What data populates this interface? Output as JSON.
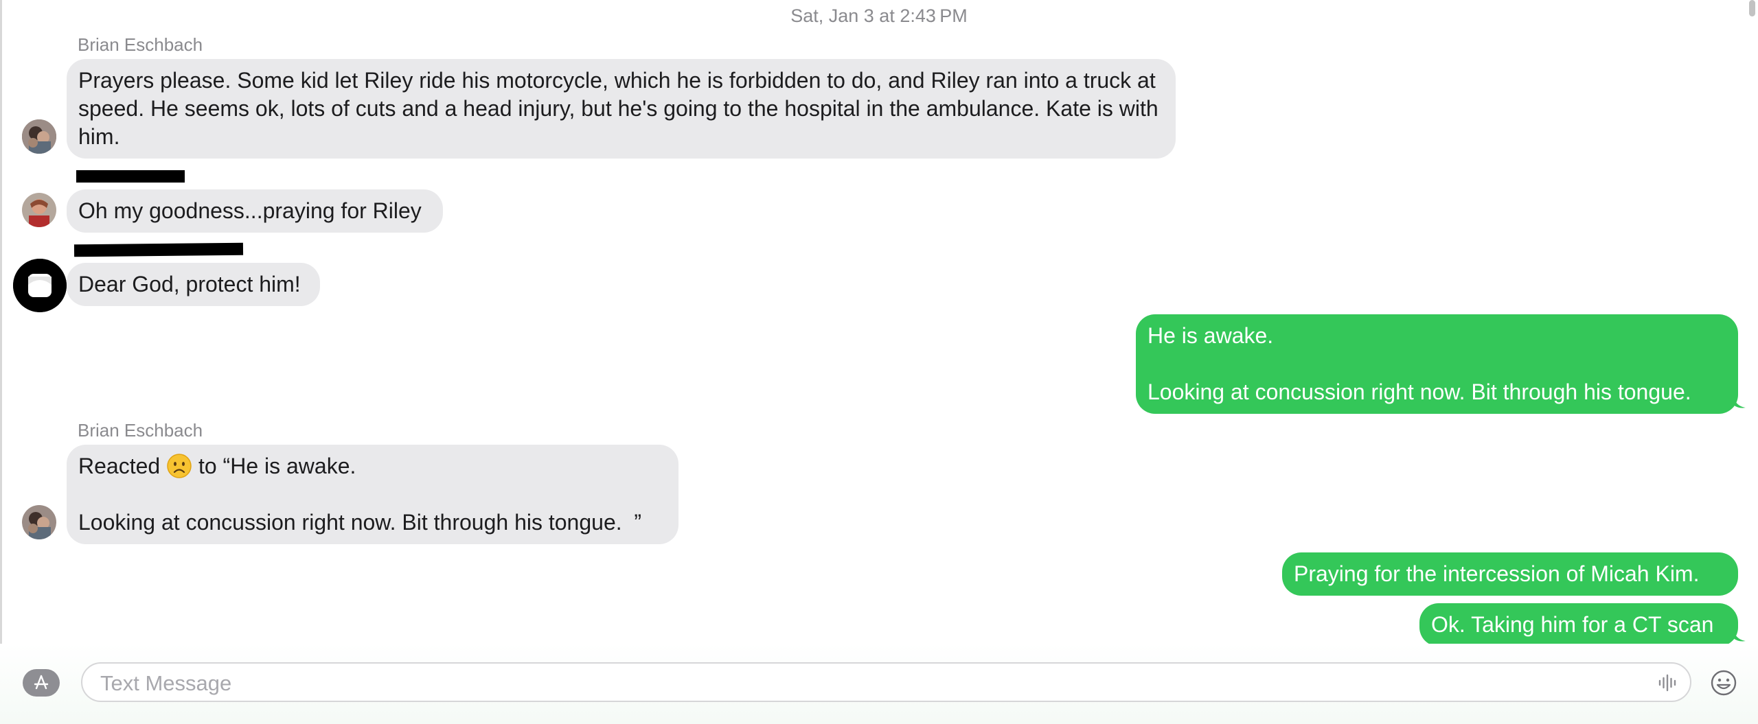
{
  "conversation": {
    "timestamp": "Sat, Jan 3 at 2:43 PM"
  },
  "messages": [
    {
      "sender": "Brian Eschbach",
      "text": "Prayers please. Some kid let Riley ride his motorcycle, which he is forbidden to do, and Riley ran into a truck at speed. He seems ok, lots of cuts and a head injury, but he's going to the hospital in the ambulance. Kate is with him."
    },
    {
      "text": "Oh my goodness...praying for Riley"
    },
    {
      "text": "Dear God, protect him!"
    },
    {
      "text": "He is awake.\n\nLooking at concussion right now. Bit through his tongue."
    },
    {
      "sender": "Brian Eschbach",
      "text_before": "Reacted ",
      "reaction_icon": "frowning-face-emoji",
      "text_after": " to “He is awake.\n\nLooking at concussion right now. Bit through his tongue.  ”"
    },
    {
      "text": "Praying for the intercession of Micah Kim."
    },
    {
      "text": "Ok. Taking him for a CT scan"
    }
  ],
  "compose": {
    "placeholder": "Text Message",
    "value": "",
    "apps_icon": "app-store-icon",
    "audio_icon": "audio-waveform-icon",
    "emoji_icon": "emoji-picker-icon"
  },
  "colors": {
    "incoming_bubble": "#e9e9eb",
    "outgoing_bubble": "#34c759",
    "secondary_text": "#8a8a8e"
  }
}
